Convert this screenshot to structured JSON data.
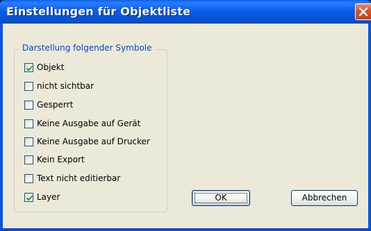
{
  "window": {
    "title": "Einstellungen für Objektliste"
  },
  "group": {
    "title": "Darstellung folgender Symbole",
    "items": [
      {
        "label": "Objekt",
        "checked": true
      },
      {
        "label": "nicht sichtbar",
        "checked": false
      },
      {
        "label": "Gesperrt",
        "checked": false
      },
      {
        "label": "Keine Ausgabe auf Gerät",
        "checked": false
      },
      {
        "label": "Keine Ausgabe auf Drucker",
        "checked": false
      },
      {
        "label": "Kein Export",
        "checked": false
      },
      {
        "label": "Text nicht editierbar",
        "checked": false
      },
      {
        "label": "Layer",
        "checked": true
      }
    ]
  },
  "buttons": {
    "ok": "OK",
    "cancel": "Abbrechen"
  },
  "icons": {
    "close": "close-icon",
    "check": "check-icon"
  },
  "colors": {
    "titlebar": "#0a5ee8",
    "dialog_bg": "#ece9d8",
    "group_label": "#0046d5",
    "check": "#21a121"
  }
}
